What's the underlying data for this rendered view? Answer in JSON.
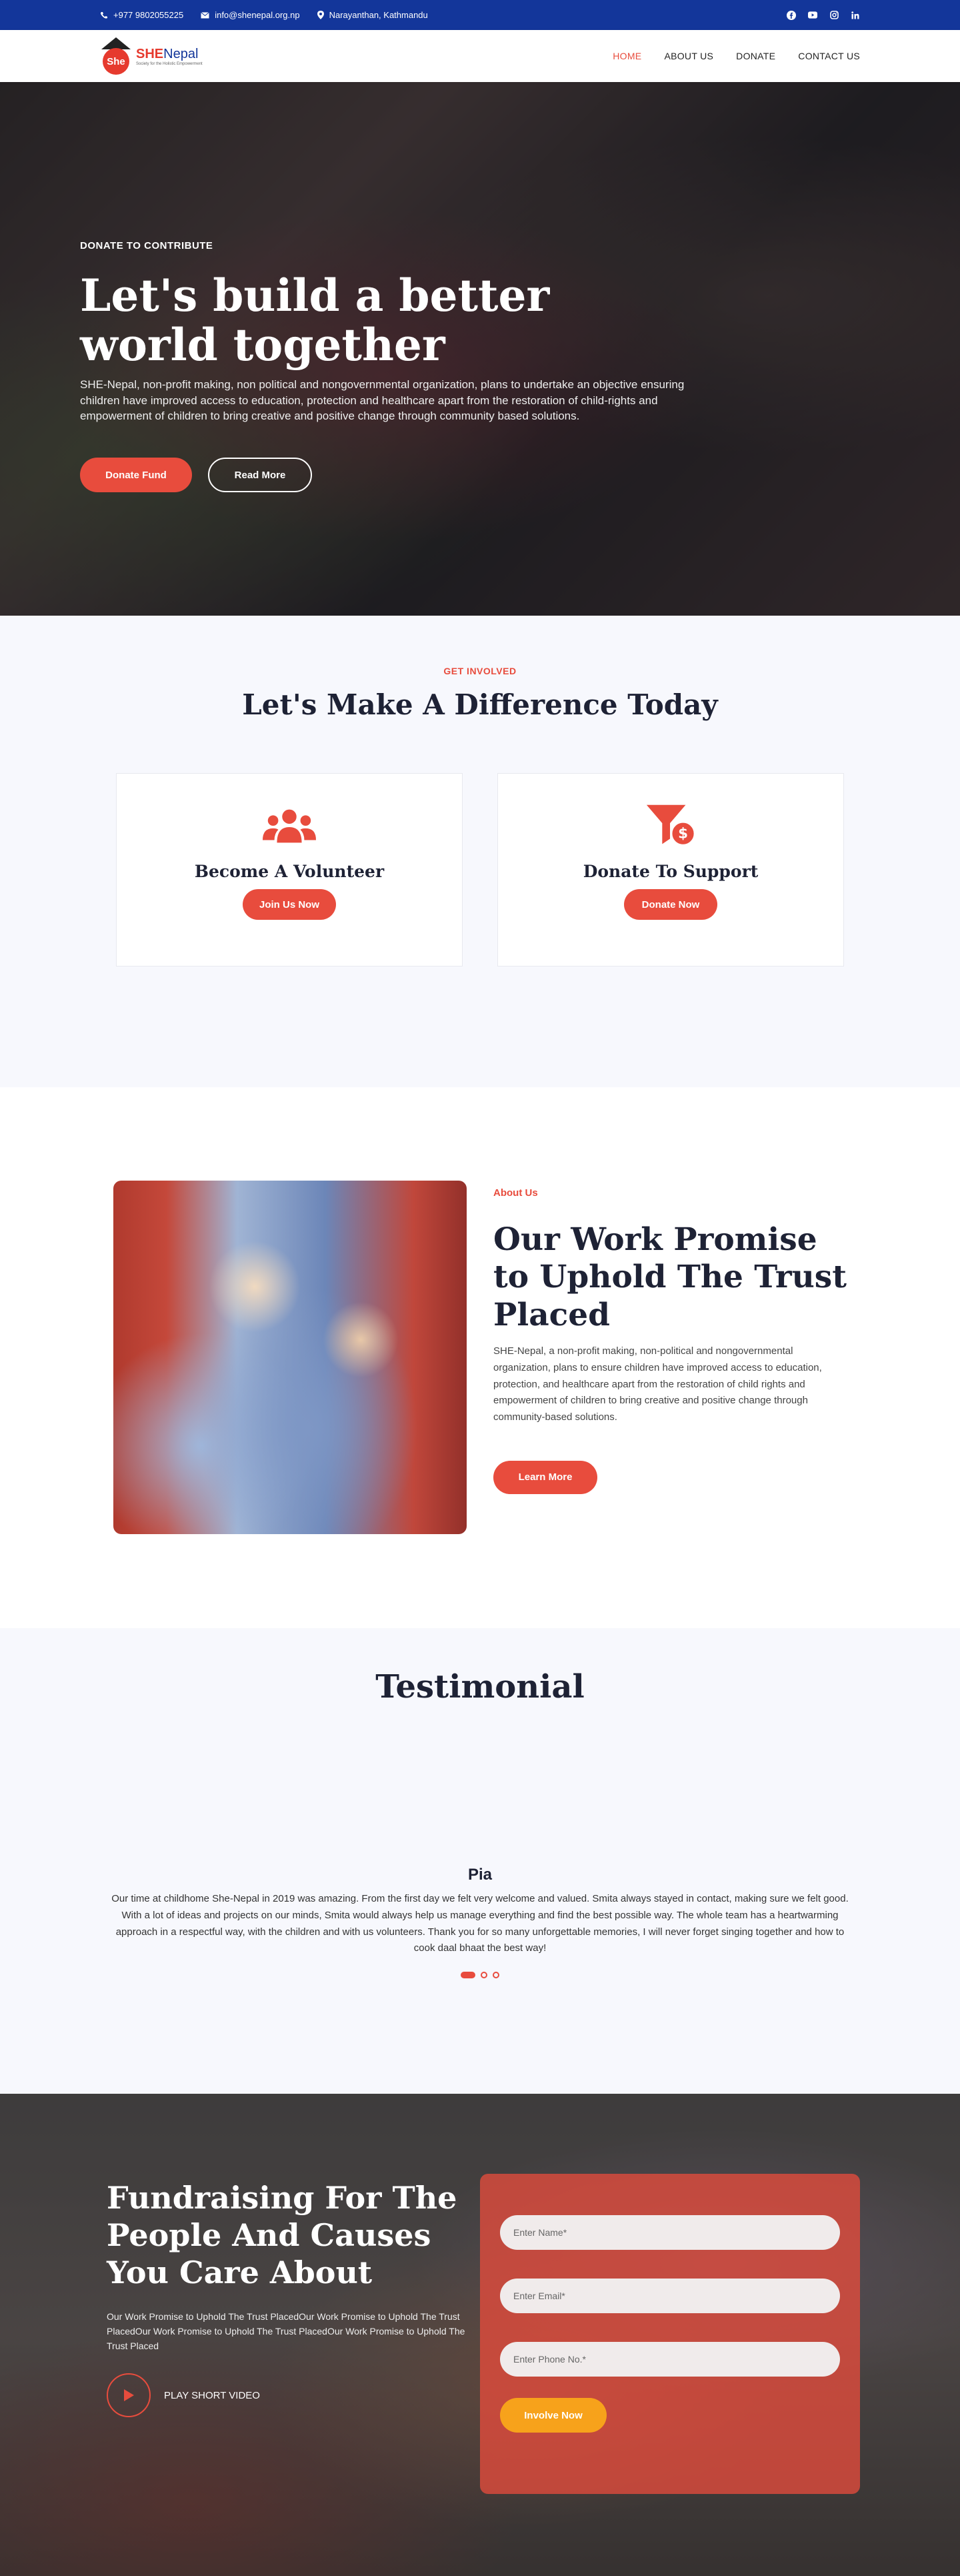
{
  "topbar": {
    "phone": "+977 9802055225",
    "email": "info@shenepal.org.np",
    "location": "Narayanthan, Kathmandu",
    "social": [
      "facebook-icon",
      "youtube-icon",
      "instagram-icon",
      "linkedin-icon"
    ]
  },
  "logo": {
    "mark": "She",
    "brand_she": "SHE",
    "brand_nepal": "Nepal",
    "tagline": "Society for the Holistic Empowerment"
  },
  "nav": {
    "items": [
      "HOME",
      "ABOUT US",
      "DONATE",
      "CONTACT US"
    ],
    "active": "HOME"
  },
  "hero": {
    "kicker": "DONATE TO CONTRIBUTE",
    "title": "Let's build a better world together",
    "text": "SHE-Nepal, non-profit making, non political and nongovernmental organization, plans to undertake an objective ensuring children have improved access to education, protection and healthcare apart from the restoration of child-rights and empowerment of children to bring creative and positive change through community based solutions.",
    "donate_btn": "Donate Fund",
    "read_btn": "Read More"
  },
  "involved": {
    "eyebrow": "GET INVOLVED",
    "title": "Let's Make A Difference Today",
    "cards": [
      {
        "title": "Become A Volunteer",
        "button": "Join Us Now",
        "icon": "users-icon"
      },
      {
        "title": "Donate To Support",
        "button": "Donate Now",
        "icon": "funnel-dollar-icon"
      }
    ]
  },
  "about": {
    "label": "About Us",
    "title": "Our Work Promise to Uphold The Trust Placed",
    "text": "SHE-Nepal, a non-profit making, non-political and nongovernmental organization, plans to ensure children have improved access to education, protection, and healthcare apart from the restoration of child rights and empowerment of children to bring creative and positive change through community-based solutions.",
    "button": "Learn More"
  },
  "testimonial": {
    "title": "Testimonial",
    "name": "Pia",
    "quote": "Our time at childhome She-Nepal in 2019 was amazing. From the first day we felt very welcome and valued. Smita always stayed in contact, making sure we felt good. With a lot of ideas and projects on our minds, Smita would always help us manage everything and find the best possible way. The whole team has a heartwarming approach in a respectful way, with the children and with us volunteers. Thank you for so many unforgettable memories, I will never forget singing together and how to cook daal bhaat the best way!",
    "slides": 3,
    "active_slide": 1
  },
  "fund": {
    "title": "Fundraising For The People And Causes You Care About",
    "text": "Our Work Promise to Uphold The Trust PlacedOur Work Promise to Uphold The Trust PlacedOur Work Promise to Uphold The Trust PlacedOur Work Promise to Uphold The Trust Placed",
    "play_label": "PLAY SHORT VIDEO",
    "form": {
      "name_placeholder": "Enter Name*",
      "email_placeholder": "Enter Email*",
      "phone_placeholder": "Enter Phone No.*",
      "button": "Involve Now"
    }
  },
  "colors": {
    "topbar": "#13369a",
    "accent": "#e84c3d",
    "orange": "#f7a21b",
    "light_bg": "#f7f8fd",
    "heading": "#1e2235"
  }
}
